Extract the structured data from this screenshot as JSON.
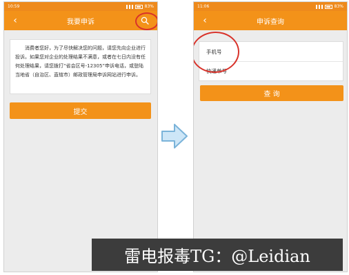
{
  "left_screen": {
    "statusbar": {
      "time": "10:59",
      "battery": "83%"
    },
    "title": "我要申诉",
    "back_glyph": "‹",
    "notice_text": "消费者您好，为了尽快解决您的问题，请您先向企业进行投诉。如果您对企业的处理结果不满意，或者在七日内没有任何处理结果，请您拨打“省会区号-12305”申诉电话，或登陆当地省（自治区、直辖市）邮政管理局申诉网站进行申诉。",
    "submit_label": "提交"
  },
  "right_screen": {
    "statusbar": {
      "time": "11:06",
      "battery": "83%"
    },
    "title": "申诉查询",
    "back_glyph": "‹",
    "fields": [
      {
        "label": "手机号",
        "value": ""
      },
      {
        "label": "快递单号",
        "value": ""
      }
    ],
    "query_label": "查 询"
  },
  "icons": {
    "search": "search-icon",
    "back": "back-arrow-icon",
    "arrow": "right-arrow-icon"
  },
  "colors": {
    "accent": "#f39219",
    "statusbar": "#ee8a1c",
    "highlight": "#d8322a",
    "arrow_fill": "#cde6f7",
    "arrow_stroke": "#7ab3d9"
  },
  "watermark": "雷电报毒TG：@Leidian"
}
